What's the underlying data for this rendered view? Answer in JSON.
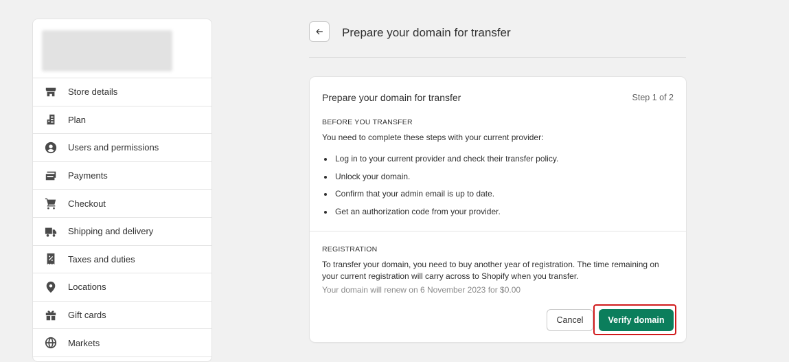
{
  "sidebar": {
    "items": [
      {
        "label": "Store details",
        "icon": "store-icon"
      },
      {
        "label": "Plan",
        "icon": "plan-icon"
      },
      {
        "label": "Users and permissions",
        "icon": "user-icon"
      },
      {
        "label": "Payments",
        "icon": "payments-icon"
      },
      {
        "label": "Checkout",
        "icon": "cart-icon"
      },
      {
        "label": "Shipping and delivery",
        "icon": "truck-icon"
      },
      {
        "label": "Taxes and duties",
        "icon": "tax-icon"
      },
      {
        "label": "Locations",
        "icon": "location-pin-icon"
      },
      {
        "label": "Gift cards",
        "icon": "gift-icon"
      },
      {
        "label": "Markets",
        "icon": "globe-icon"
      }
    ]
  },
  "header": {
    "back_icon": "arrow-left-icon",
    "title": "Prepare your domain for transfer"
  },
  "card": {
    "title": "Prepare your domain for transfer",
    "step": "Step 1 of 2",
    "before": {
      "heading": "BEFORE YOU TRANSFER",
      "intro": "You need to complete these steps with your current provider:",
      "steps": [
        "Log in to your current provider and check their transfer policy.",
        "Unlock your domain.",
        "Confirm that your admin email is up to date.",
        "Get an authorization code from your provider."
      ]
    },
    "registration": {
      "heading": "REGISTRATION",
      "text": "To transfer your domain, you need to buy another year of registration. The time remaining on your current registration will carry across to Shopify when you transfer.",
      "renewal": "Your domain will renew on 6 November 2023 for $0.00"
    },
    "actions": {
      "cancel": "Cancel",
      "verify": "Verify domain"
    }
  },
  "colors": {
    "primary": "#0b7e5c",
    "highlight": "#d0191b",
    "background": "#f1f1f1"
  }
}
